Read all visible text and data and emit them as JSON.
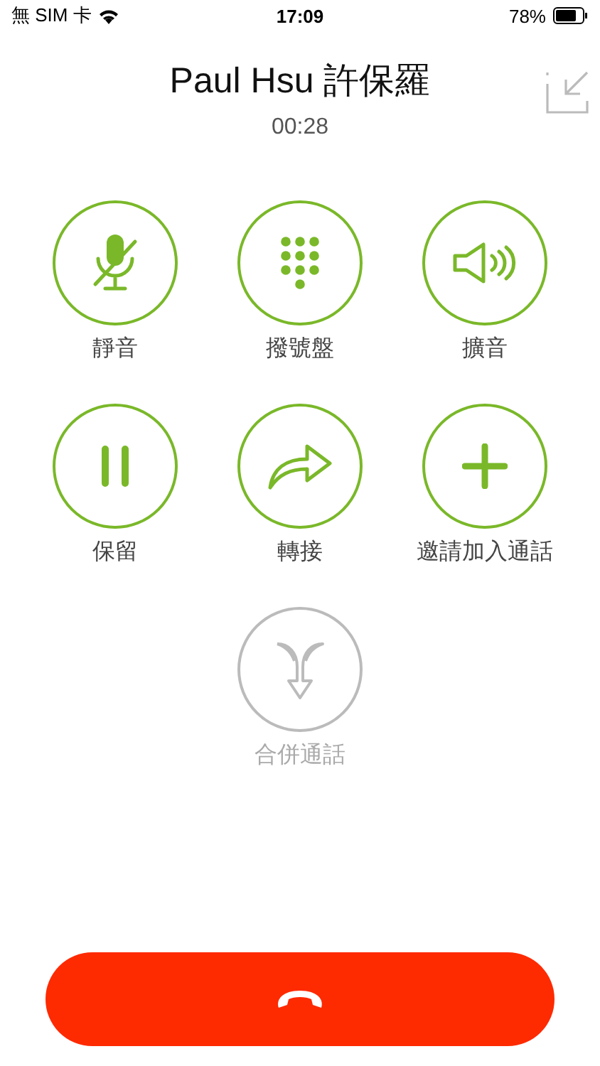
{
  "status_bar": {
    "carrier": "無 SIM 卡",
    "time": "17:09",
    "battery": "78%"
  },
  "call": {
    "name": "Paul Hsu 許保羅",
    "duration": "00:28"
  },
  "actions": [
    {
      "kind": "mute",
      "label": "靜音",
      "disabled": false
    },
    {
      "kind": "keypad",
      "label": "撥號盤",
      "disabled": false
    },
    {
      "kind": "speaker",
      "label": "擴音",
      "disabled": false
    },
    {
      "kind": "hold",
      "label": "保留",
      "disabled": false
    },
    {
      "kind": "transfer",
      "label": "轉接",
      "disabled": false
    },
    {
      "kind": "add",
      "label": "邀請加入通話",
      "disabled": false
    },
    {
      "kind": "merge",
      "label": "合併通話",
      "disabled": true
    }
  ]
}
